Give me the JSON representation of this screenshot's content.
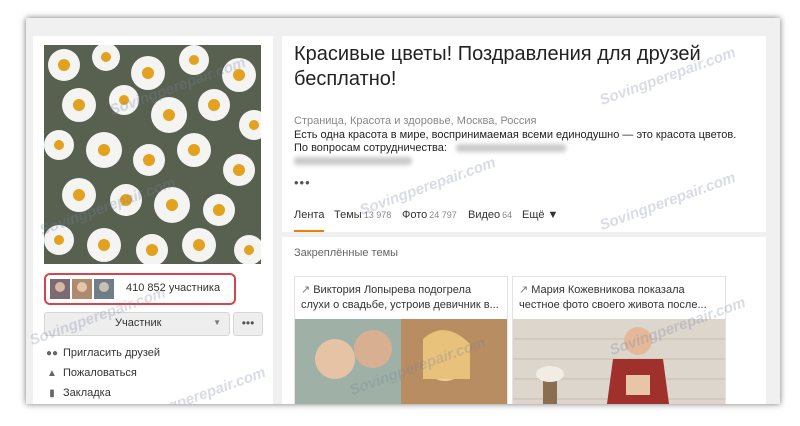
{
  "group": {
    "title": "Красивые цветы! Поздравления для друзей бесплатно!",
    "meta": "Страница, Красота и здоровье, Москва, Россия",
    "description": "Есть одна красота в мире, воспринимаемая всеми единодушно — это красота цветов.",
    "contact_label": "По вопросам сотрудничества:",
    "ellipsis": "•••"
  },
  "members": {
    "count": "410 852 участника"
  },
  "buttons": {
    "member_label": "Участник",
    "member_arrow": "▼",
    "more_label": "•••"
  },
  "actions": [
    {
      "label": "Пригласить друзей",
      "icon": "people-icon"
    },
    {
      "label": "Пожаловаться",
      "icon": "warning-icon"
    },
    {
      "label": "Закладка",
      "icon": "bookmark-icon"
    }
  ],
  "tabs": [
    {
      "label": "Лента",
      "count": ""
    },
    {
      "label": "Темы",
      "count": "13 978"
    },
    {
      "label": "Фото",
      "count": "24 797"
    },
    {
      "label": "Видео",
      "count": "64"
    },
    {
      "label": "Ещё ▼",
      "count": ""
    }
  ],
  "pinned": {
    "heading": "Закреплённые темы",
    "cards": [
      {
        "text": "Виктория Лопырева подогрела слухи о свадьбе, устроив девичник в..."
      },
      {
        "text": "Мария Кожевникова показала честное фото своего живота после..."
      }
    ]
  },
  "watermark": "Sovingperepair.com",
  "colors": {
    "accent": "#f07f00",
    "highlight": "#d9434b",
    "background": "#f0f0f0"
  }
}
